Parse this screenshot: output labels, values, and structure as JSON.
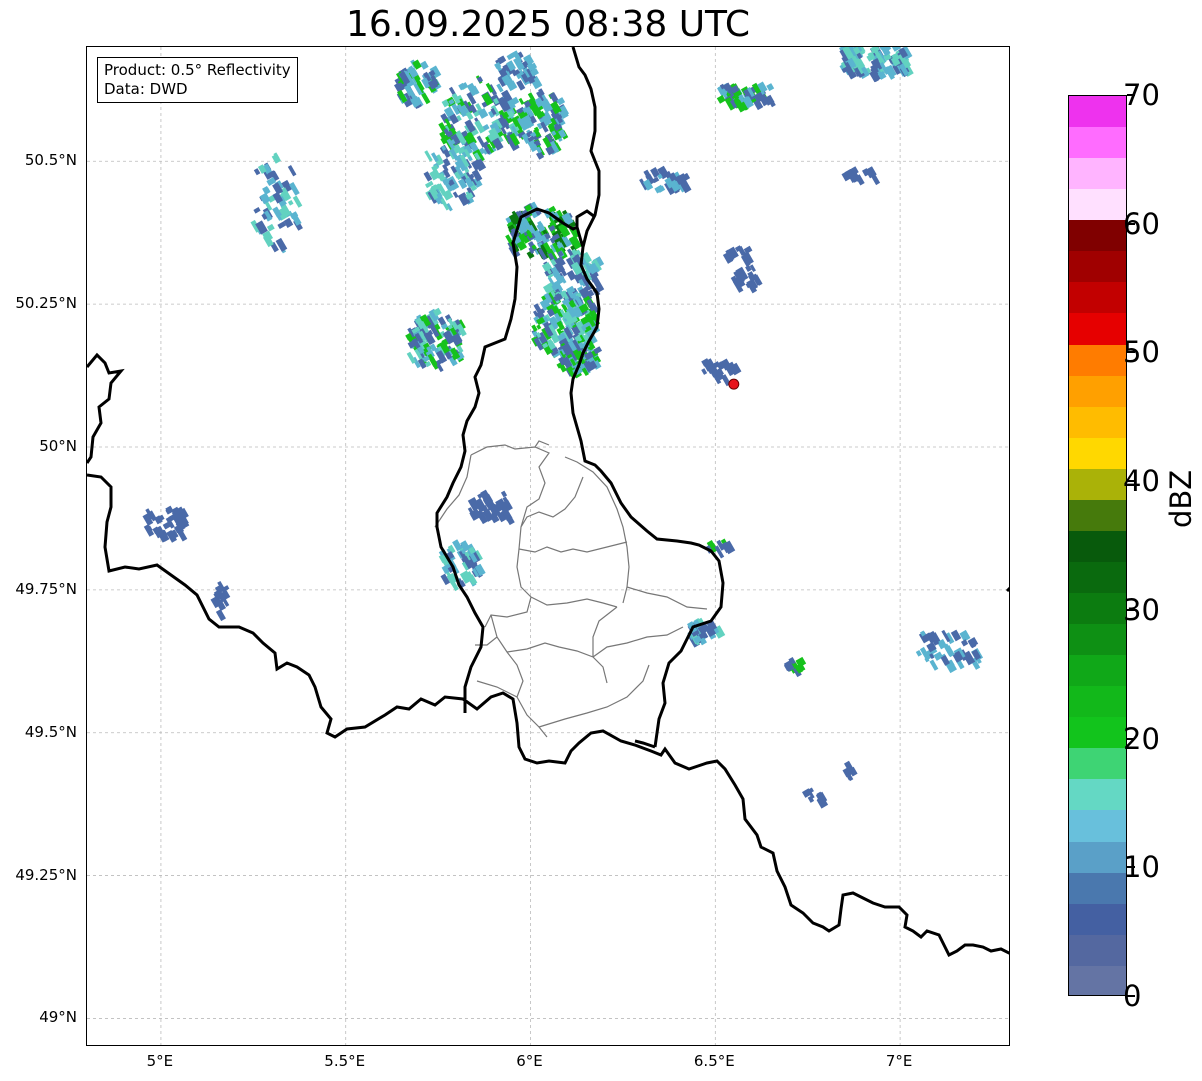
{
  "title": "16.09.2025 08:38 UTC",
  "info_box": {
    "line1": "Product: 0.5° Reflectivity",
    "line2": "Data: DWD"
  },
  "map": {
    "lon_range": [
      4.8,
      7.3
    ],
    "lat_range": [
      48.95,
      50.7
    ],
    "lon_ticks": [
      {
        "value": 5.0,
        "label": "5°E"
      },
      {
        "value": 5.5,
        "label": "5.5°E"
      },
      {
        "value": 6.0,
        "label": "6°E"
      },
      {
        "value": 6.5,
        "label": "6.5°E"
      },
      {
        "value": 7.0,
        "label": "7°E"
      }
    ],
    "lat_ticks": [
      {
        "value": 50.5,
        "label": "50.5°N"
      },
      {
        "value": 50.25,
        "label": "50.25°N"
      },
      {
        "value": 50.0,
        "label": "50°N"
      },
      {
        "value": 49.75,
        "label": "49.75°N"
      },
      {
        "value": 49.5,
        "label": "49.5°N"
      },
      {
        "value": 49.25,
        "label": "49.25°N"
      },
      {
        "value": 49.0,
        "label": "49°N"
      }
    ],
    "gridlines": true,
    "marker": {
      "lon": 6.55,
      "lat": 50.11,
      "color": "#e8141c",
      "name": "red-location-marker"
    },
    "echo_colors": {
      "light": "#4a6aa8",
      "mid": "#5ab4d0",
      "cyan": "#62d2c0",
      "green": "#16c21c",
      "dark_green": "#0a7a10"
    }
  },
  "colorbar": {
    "label": "dBZ",
    "min": 0,
    "max": 70,
    "ticks": [
      {
        "value": 0,
        "label": "0"
      },
      {
        "value": 10,
        "label": "10"
      },
      {
        "value": 20,
        "label": "20"
      },
      {
        "value": 30,
        "label": "30"
      },
      {
        "value": 40,
        "label": "40"
      },
      {
        "value": 50,
        "label": "50"
      },
      {
        "value": 60,
        "label": "60"
      },
      {
        "value": 70,
        "label": "70"
      }
    ],
    "colors": [
      "#6474a4",
      "#5468a0",
      "#4460a2",
      "#4a78ae",
      "#5aa0c8",
      "#68c0dc",
      "#64d8c4",
      "#3ed474",
      "#12c41c",
      "#12b81a",
      "#10a818",
      "#0e9014",
      "#0c7c10",
      "#0a6a0e",
      "#085a0c",
      "#467a0c",
      "#aab208",
      "#ffd800",
      "#ffbc00",
      "#ffa000",
      "#ff7c00",
      "#e60000",
      "#c20000",
      "#a00000",
      "#800000",
      "#ffe0ff",
      "#ffb4ff",
      "#ff6cff",
      "#ee32ee"
    ]
  }
}
